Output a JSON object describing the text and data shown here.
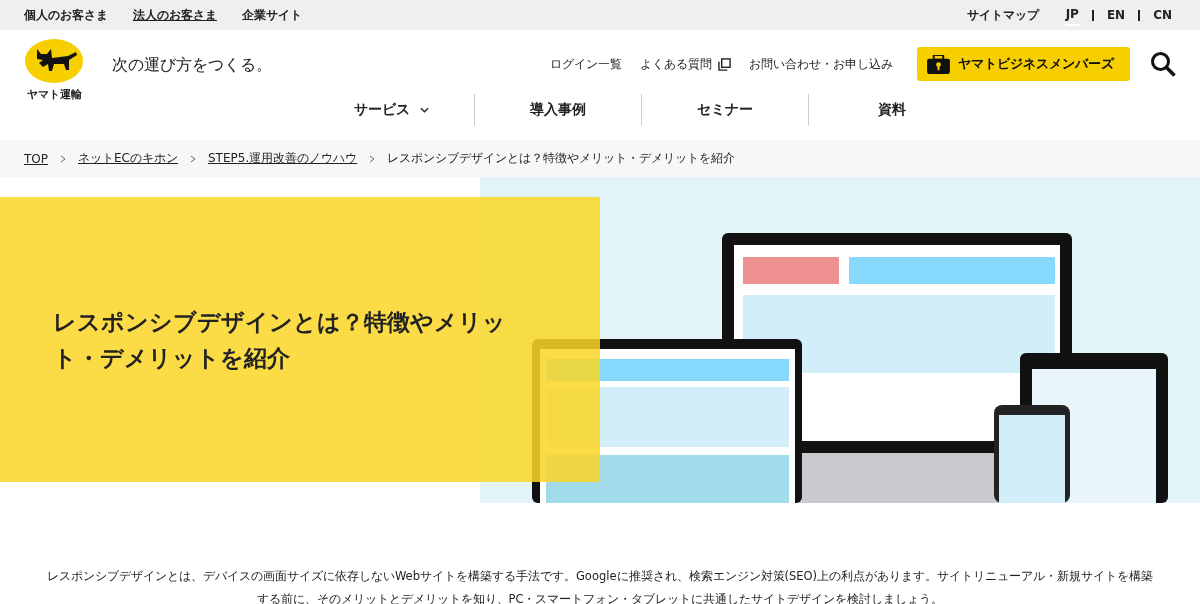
{
  "top_bar": {
    "audience_links": [
      {
        "label": "個人のお客さま",
        "selected": false
      },
      {
        "label": "法人のお客さま",
        "selected": true
      },
      {
        "label": "企業サイト",
        "selected": false
      }
    ],
    "sitemap": "サイトマップ",
    "languages": [
      {
        "label": "JP",
        "selected": true
      },
      {
        "label": "EN",
        "selected": false
      },
      {
        "label": "CN",
        "selected": false
      }
    ]
  },
  "header": {
    "logo_text": "ヤマト運輸",
    "tagline": "次の運び方をつくる。",
    "utility_links": [
      {
        "label": "ログイン一覧",
        "external": false
      },
      {
        "label": "よくある質問",
        "external": true
      },
      {
        "label": "お問い合わせ・お申し込み",
        "external": false
      }
    ],
    "member_button": "ヤマトビジネスメンバーズ"
  },
  "nav": [
    {
      "label": "サービス",
      "dropdown": true
    },
    {
      "label": "導入事例",
      "dropdown": false
    },
    {
      "label": "セミナー",
      "dropdown": false
    },
    {
      "label": "資料",
      "dropdown": false
    }
  ],
  "breadcrumb": [
    {
      "label": "TOP",
      "link": true
    },
    {
      "label": "ネットECのキホン",
      "link": true
    },
    {
      "label": "STEP5.運用改善のノウハウ",
      "link": true
    },
    {
      "label": "レスポンシブデザインとは？特徴やメリット・デメリットを紹介",
      "link": false
    }
  ],
  "hero": {
    "title": "レスポンシブデザインとは？特徴やメリット・デメリットを紹介"
  },
  "intro": "レスポンシブデザインとは、デバイスの画面サイズに依存しないWebサイトを構築する手法です。Googleに推奨され、検索エンジン対策(SEO)上の利点があります。サイトリニューアル・新規サイトを構築する前に、そのメリットとデメリットを知り、PC・スマートフォン・タブレットに共通したサイトデザインを検討しましょう。"
}
